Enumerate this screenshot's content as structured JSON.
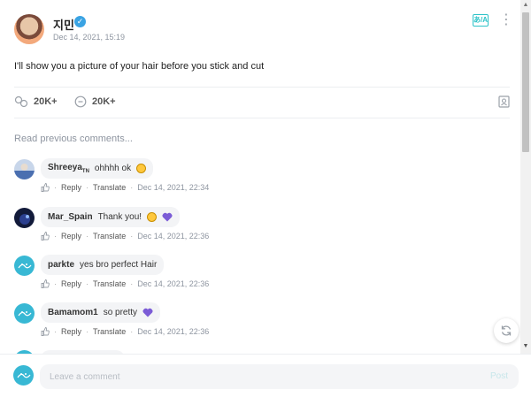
{
  "post": {
    "author": "지민",
    "date": "Dec 14, 2021, 15:19",
    "body": "I'll show you a picture of your hair before you stick and cut",
    "likes": "20K+",
    "comments": "20K+",
    "translate_icon_label": "あ/A"
  },
  "read_previous": "Read previous comments...",
  "comments": [
    {
      "name": "Shreeya",
      "name_suffix": "TN",
      "text": "ohhhh ok",
      "emojis": [
        "smile"
      ],
      "reply": "Reply",
      "translate": "Translate",
      "time": "Dec 14, 2021, 22:34"
    },
    {
      "name": "Mar_Spain",
      "name_suffix": "",
      "text": "Thank you!",
      "emojis": [
        "smile",
        "heart"
      ],
      "reply": "Reply",
      "translate": "Translate",
      "time": "Dec 14, 2021, 22:36"
    },
    {
      "name": "parkte",
      "name_suffix": "",
      "text": "yes bro perfect Hair",
      "emojis": [],
      "reply": "Reply",
      "translate": "Translate",
      "time": "Dec 14, 2021, 22:36"
    },
    {
      "name": "Bamamom1",
      "name_suffix": "",
      "text": "so pretty",
      "emojis": [
        "heart"
      ],
      "reply": "Reply",
      "translate": "Translate",
      "time": "Dec 14, 2021, 22:36"
    }
  ],
  "footer": {
    "placeholder": "Leave a comment",
    "post_label": "Post"
  },
  "colors": {
    "accent": "#2dc3c8",
    "verified": "#3aa3e3",
    "heart": "#7b5cd6"
  }
}
